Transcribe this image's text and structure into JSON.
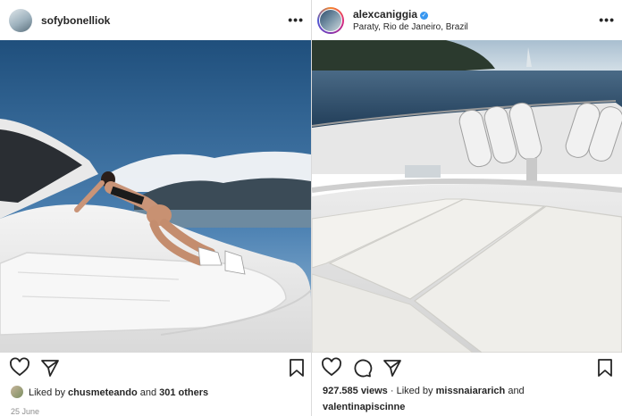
{
  "left_post": {
    "username": "sofybonelliok",
    "more_label": "•••",
    "likes": {
      "prefix": "Liked by ",
      "user": "chusmeteando",
      "joiner": " and ",
      "others": "301 others"
    },
    "date": "25 June",
    "icons": [
      "heart-icon",
      "send-icon",
      "bookmark-icon"
    ]
  },
  "right_post": {
    "username": "alexcaniggia",
    "verified": true,
    "location": "Paraty, Rio de Janeiro, Brazil",
    "more_label": "•••",
    "views": {
      "count": "927.585 views",
      "middle": " · Liked by ",
      "user1": "missnaiararich",
      "joiner": " and",
      "user2": "valentinapiscinne"
    },
    "icons": [
      "heart-icon",
      "comment-icon",
      "send-icon",
      "bookmark-icon"
    ]
  },
  "colors": {
    "text": "#262626",
    "muted": "#8e8e8e",
    "verified": "#3897f0",
    "divider": "#dbdbdb"
  }
}
